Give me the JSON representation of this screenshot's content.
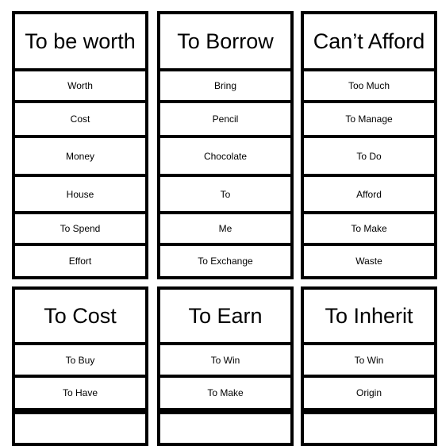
{
  "cards": [
    {
      "title": "To be worth",
      "items": [
        "Worth",
        "Cost",
        "Money",
        "House",
        "To Spend",
        "Effort"
      ]
    },
    {
      "title": "To Borrow",
      "items": [
        "Bring",
        "Pencil",
        "Chocolate",
        "To",
        "Me",
        "To Exchange"
      ]
    },
    {
      "title": "Can’t Afford",
      "items": [
        "Too Much",
        "To Manage",
        "To Do",
        "Afford",
        "To Make",
        "Waste"
      ]
    },
    {
      "title": "To Cost",
      "items": [
        "To Buy",
        "To Have"
      ]
    },
    {
      "title": "To Earn",
      "items": [
        "To Win",
        "To Make"
      ]
    },
    {
      "title": "To Inherit",
      "items": [
        "To Win",
        "Origin"
      ]
    }
  ]
}
